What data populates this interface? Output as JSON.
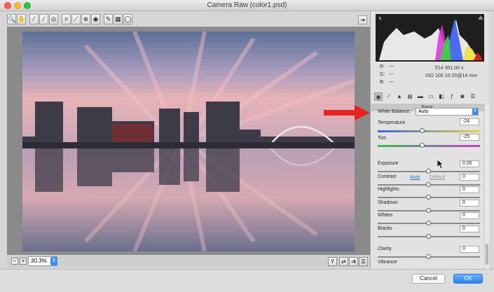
{
  "window": {
    "title": "Camera Raw (color1.psd)"
  },
  "toolbar": {
    "tools": [
      {
        "icon": "zoom-icon",
        "glyph": "🔍"
      },
      {
        "icon": "hand-icon",
        "glyph": "✋"
      },
      {
        "icon": "white-balance-icon",
        "glyph": "⁄"
      },
      {
        "icon": "color-sampler-icon",
        "glyph": "⁄"
      },
      {
        "icon": "targeted-adjust-icon",
        "glyph": "◎"
      },
      {
        "icon": "crop-icon",
        "glyph": "⌗"
      },
      {
        "icon": "straighten-icon",
        "glyph": "⟋"
      },
      {
        "icon": "spot-removal-icon",
        "glyph": "⊕"
      },
      {
        "icon": "red-eye-icon",
        "glyph": "◉"
      },
      {
        "icon": "adjustment-brush-icon",
        "glyph": "✎"
      },
      {
        "icon": "graduated-filter-icon",
        "glyph": "▦"
      },
      {
        "icon": "radial-filter-icon",
        "glyph": "◯"
      }
    ]
  },
  "preview": {
    "zoom": "30.3%"
  },
  "readout": {
    "r_label": "R:",
    "r_value": "---",
    "g_label": "G:",
    "g_value": "---",
    "b_label": "B:",
    "b_value": "---",
    "aperture_shutter": "f/14   301.00 s",
    "iso_lens": "ISO 100   10-20@14 mm"
  },
  "panel": {
    "section_title": "Basic",
    "white_balance": {
      "label": "White Balance:",
      "value": "Auto"
    },
    "auto_link": "Auto",
    "default_link": "Default",
    "sliders": [
      {
        "label": "Temperature",
        "value": "-24",
        "position": 0.44
      },
      {
        "label": "Tint",
        "value": "-25",
        "position": 0.44
      },
      {
        "label": "Exposure",
        "value": "0.00",
        "position": 0.5
      },
      {
        "label": "Contrast",
        "value": "0",
        "position": 0.5
      },
      {
        "label": "Highlights",
        "value": "0",
        "position": 0.5
      },
      {
        "label": "Shadows",
        "value": "0",
        "position": 0.5
      },
      {
        "label": "Whites",
        "value": "0",
        "position": 0.5
      },
      {
        "label": "Blacks",
        "value": "0",
        "position": 0.5
      },
      {
        "label": "Clarity",
        "value": "0",
        "position": 0.5
      },
      {
        "label": "Vibrance",
        "value": "",
        "position": 0.5
      }
    ]
  },
  "buttons": {
    "cancel": "Cancel",
    "ok": "OK"
  },
  "colors": {
    "accent": "#3d8ef0",
    "arrow": "#e8231f"
  }
}
